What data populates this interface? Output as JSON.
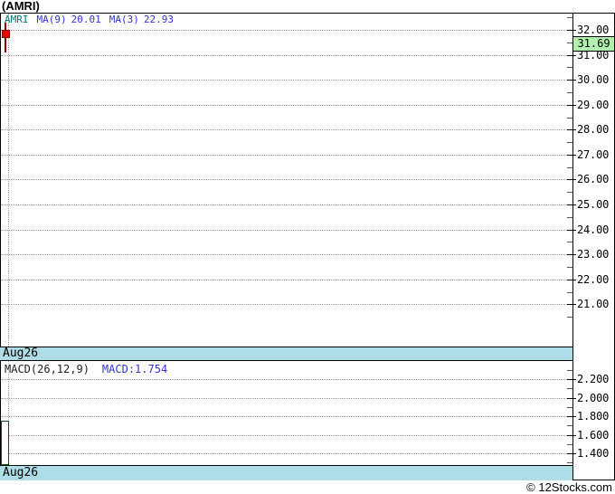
{
  "title": "(AMRI)",
  "watermark": "© 12Stocks.com",
  "colors": {
    "accent_datebar": "#aedde8",
    "last_price_bg": "#b2f0ae",
    "candle_down_fill": "#e80000",
    "candle_down_border": "#8b0000",
    "macd_bar_border": "#005500",
    "legend_symbol": "#007878",
    "legend_ma": "#3333cc",
    "gridline": "#999999"
  },
  "chart_data": [
    {
      "type": "candlestick",
      "panel": "price",
      "symbol": "AMRI",
      "legend": {
        "symbol": "AMRI",
        "ma9_label": "MA(9)",
        "ma9_value": "20.01",
        "ma3_label": "MA(3)",
        "ma3_value": "22.93"
      },
      "last_price_label": "31.69",
      "yticks": [
        32,
        31,
        30,
        29,
        28,
        27,
        26,
        25,
        24,
        23,
        22,
        21
      ],
      "ytick_labels": [
        "32.00",
        "31.00",
        "30.00",
        "29.00",
        "28.00",
        "27.00",
        "26.00",
        "25.00",
        "24.00",
        "23.00",
        "22.00",
        "21.00"
      ],
      "ylim": [
        20.55,
        32.7
      ],
      "grid": true,
      "legend_position": "top-left",
      "x_labels": [
        "Aug26"
      ],
      "date_label": "Aug26",
      "candle": {
        "date": "Aug26",
        "open": 32.0,
        "high": 32.3,
        "low": 31.1,
        "close": 31.69,
        "direction": "down"
      }
    },
    {
      "type": "bar",
      "panel": "macd",
      "legend_label": "MACD(26,12,9)",
      "legend_value": "MACD:1.754",
      "macd_value": 1.754,
      "values": [
        1.754
      ],
      "yticks": [
        2.2,
        2.0,
        1.8,
        1.6,
        1.4
      ],
      "ytick_labels": [
        "2.200",
        "2.000",
        "1.800",
        "1.600",
        "1.400"
      ],
      "ylim": [
        1.27,
        2.33
      ],
      "grid": true,
      "x_labels": [
        "Aug26"
      ],
      "date_label": "Aug26"
    }
  ]
}
